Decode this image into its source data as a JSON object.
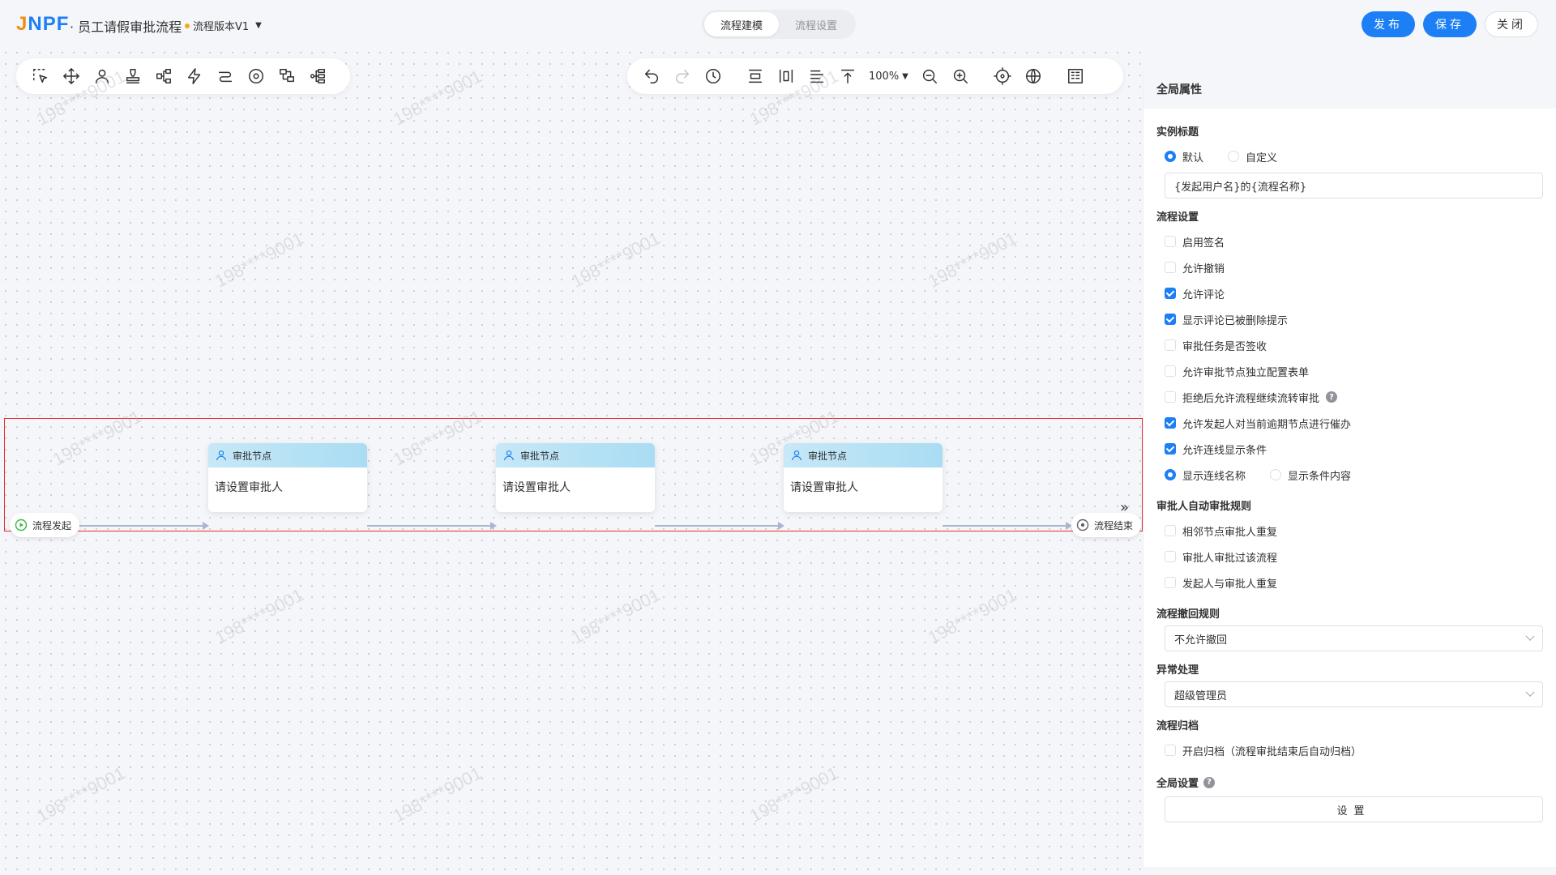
{
  "header": {
    "logo_part1": "J",
    "logo_part2": "NPF",
    "app_title": "· 员工请假审批流程",
    "version_label": "流程版本V1",
    "mode_tabs": [
      {
        "label": "流程建模",
        "active": true
      },
      {
        "label": "流程设置",
        "active": false
      }
    ],
    "buttons": {
      "publish": "发布",
      "save": "保存",
      "close": "关闭"
    }
  },
  "toolbar": {
    "zoom_level": "100%",
    "left_tools": [
      "select-icon",
      "move-icon",
      "approver-icon",
      "stamp-icon",
      "branch-icon",
      "trigger-icon",
      "route-icon",
      "target-icon",
      "subflow-icon",
      "parallel-icon"
    ],
    "right_tools": [
      "undo-icon",
      "redo-icon",
      "history-icon",
      "align-vertical-icon",
      "align-columns-icon",
      "align-left-icon",
      "align-top-icon",
      "zoom-out-icon",
      "zoom-in-icon",
      "locate-icon",
      "global-icon",
      "minimap-icon"
    ]
  },
  "flow": {
    "start_label": "流程发起",
    "end_label": "流程结束",
    "nodes": [
      {
        "header": "审批节点",
        "body": "请设置审批人"
      },
      {
        "header": "审批节点",
        "body": "请设置审批人"
      },
      {
        "header": "审批节点",
        "body": "请设置审批人"
      }
    ]
  },
  "watermark_text": "198****9001",
  "panel": {
    "title": "全局属性",
    "instance_title": {
      "label": "实例标题",
      "option_default": "默认",
      "option_custom": "自定义",
      "selected": "默认",
      "value": "{发起用户名}的{流程名称}"
    },
    "flow_settings": {
      "label": "流程设置",
      "items": [
        {
          "label": "启用签名",
          "checked": false
        },
        {
          "label": "允许撤销",
          "checked": false
        },
        {
          "label": "允许评论",
          "checked": true
        },
        {
          "label": "显示评论已被删除提示",
          "checked": true
        },
        {
          "label": "审批任务是否签收",
          "checked": false
        },
        {
          "label": "允许审批节点独立配置表单",
          "checked": false
        },
        {
          "label": "拒绝后允许流程继续流转审批",
          "checked": false,
          "help": true
        },
        {
          "label": "允许发起人对当前逾期节点进行催办",
          "checked": true
        },
        {
          "label": "允许连线显示条件",
          "checked": true
        }
      ],
      "line_display": {
        "option_name": "显示连线名称",
        "option_condition": "显示条件内容",
        "selected": "显示连线名称"
      }
    },
    "auto_approve": {
      "label": "审批人自动审批规则",
      "items": [
        {
          "label": "相邻节点审批人重复",
          "checked": false
        },
        {
          "label": "审批人审批过该流程",
          "checked": false
        },
        {
          "label": "发起人与审批人重复",
          "checked": false
        }
      ]
    },
    "revoke_rule": {
      "label": "流程撤回规则",
      "value": "不允许撤回"
    },
    "exception": {
      "label": "异常处理",
      "value": "超级管理员"
    },
    "archive": {
      "label": "流程归档",
      "item": "开启归档（流程审批结束后自动归档）",
      "checked": false
    },
    "global_settings": {
      "label": "全局设置",
      "button": "设置"
    }
  },
  "colors": {
    "primary": "#1d7ff5",
    "logo_orange": "#f08c1a",
    "selection_red": "#e62e2e",
    "node_header": "#b8e2f5"
  }
}
